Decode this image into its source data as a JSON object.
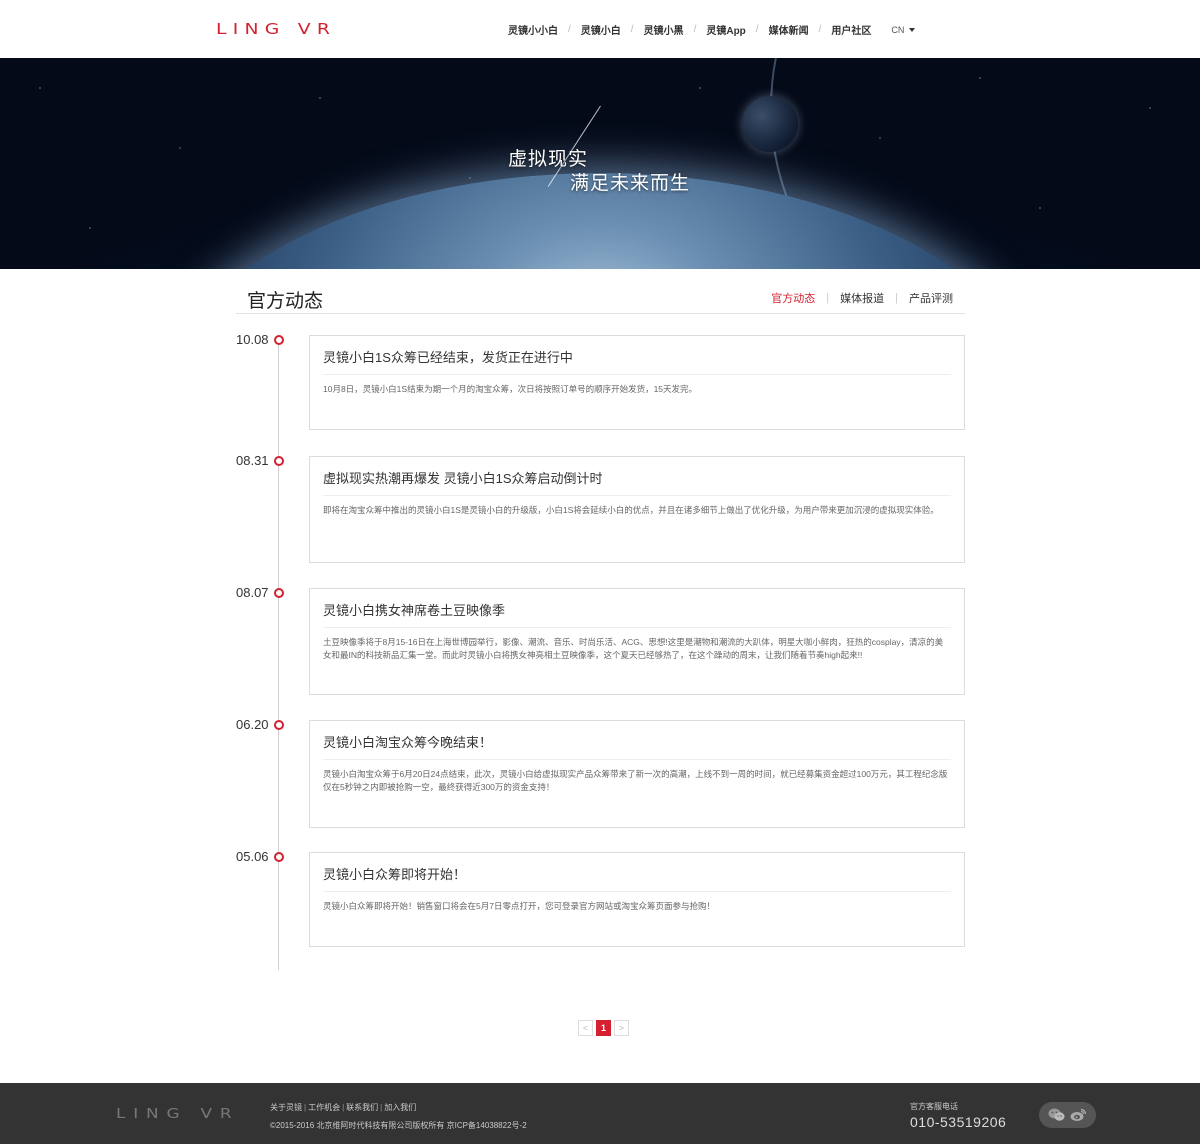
{
  "header": {
    "logo": "LING VR",
    "nav": [
      "灵镜小小白",
      "灵镜小白",
      "灵镜小黑",
      "灵镜App",
      "媒体新闻",
      "用户社区"
    ],
    "lang": "CN"
  },
  "banner": {
    "line1": "虚拟现实",
    "line2": "满足未来而生"
  },
  "section": {
    "title": "官方动态",
    "tabs": [
      "官方动态",
      "媒体报道",
      "产品评测"
    ],
    "active_tab": "官方动态"
  },
  "timeline": [
    {
      "date": "10.08",
      "title": "灵镜小白1S众筹已经结束，发货正在进行中",
      "body": "10月8日，灵镜小白1S结束为期一个月的淘宝众筹，次日将按照订单号的顺序开始发货，15天发完。"
    },
    {
      "date": "08.31",
      "title": "虚拟现实热潮再爆发 灵镜小白1S众筹启动倒计时",
      "body": "即将在淘宝众筹中推出的灵镜小白1S是灵镜小白的升级版，小白1S将会延续小白的优点，并且在诸多细节上做出了优化升级，为用户带来更加沉浸的虚拟现实体验。"
    },
    {
      "date": "08.07",
      "title": "灵镜小白携女神席卷土豆映像季",
      "body": "土豆映像季将于8月15-16日在上海世博园举行，影像、潮流、音乐、时尚乐活、ACG、思想!这里是潮物和潮流的大趴体，明星大咖小鲜肉，狂热的cosplay，清凉的美女和最IN的科技新品汇集一堂。而此时灵镜小白将携女神亮相土豆映像季，这个夏天已经够热了，在这个躁动的周末，让我们随着节奏high起来!!"
    },
    {
      "date": "06.20",
      "title": "灵镜小白淘宝众筹今晚结束！",
      "body": "灵镜小白淘宝众筹于6月20日24点结束，此次，灵镜小白给虚拟现实产品众筹带来了新一次的高潮，上线不到一周的时间，就已经募集资金超过100万元，其工程纪念版仅在5秒钟之内即被抢购一空，最终获得近300万的资金支持！"
    },
    {
      "date": "05.06",
      "title": "灵镜小白众筹即将开始！",
      "body": "灵镜小白众筹即将开始！销售窗口将会在5月7日零点打开，您可登录官方网站或淘宝众筹页面参与抢购！"
    }
  ],
  "pagination": {
    "prev": "<",
    "current": "1",
    "next": ">"
  },
  "footer": {
    "logo": "LING VR",
    "links": [
      "关于灵镜",
      "工作机会",
      "联系我们",
      "加入我们"
    ],
    "copyright": "©2015-2016 北京维阿时代科技有限公司版权所有 京ICP备14038822号-2",
    "hotline_label": "官方客服电话",
    "hotline": "010-53519206",
    "social_icons": [
      "wechat-icon",
      "weibo-icon"
    ]
  },
  "colors": {
    "accent": "#d4202f",
    "footer_bg": "#333333"
  }
}
